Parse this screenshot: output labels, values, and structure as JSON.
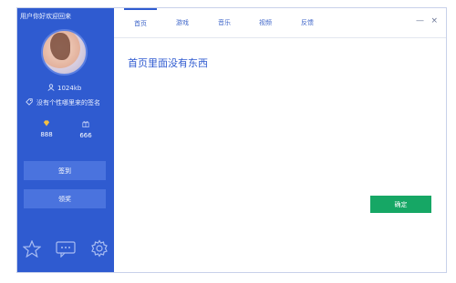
{
  "sidebar": {
    "greeting": "用户你好欢迎回来",
    "storage": "1024kb",
    "signature": "没有个性哪里来的签名",
    "stats": [
      {
        "icon": "diamond-icon",
        "value": "888"
      },
      {
        "icon": "gift-icon",
        "value": "666"
      }
    ],
    "sign_in_label": "签到",
    "award_label": "领奖",
    "bottom_icons": [
      "star-icon",
      "message-icon",
      "gear-icon"
    ]
  },
  "tabs": [
    {
      "label": "首页",
      "active": true
    },
    {
      "label": "游戏",
      "active": false
    },
    {
      "label": "音乐",
      "active": false
    },
    {
      "label": "视频",
      "active": false
    },
    {
      "label": "反馈",
      "active": false
    }
  ],
  "window_controls": {
    "minimize": "—",
    "close": "×"
  },
  "content": {
    "title": "首页里面没有东西"
  },
  "confirm_label": "确定",
  "colors": {
    "sidebar": "#2f5bd0",
    "sidebar_button": "#4a73de",
    "confirm": "#16a765",
    "accent_text": "#2f5bd0"
  }
}
